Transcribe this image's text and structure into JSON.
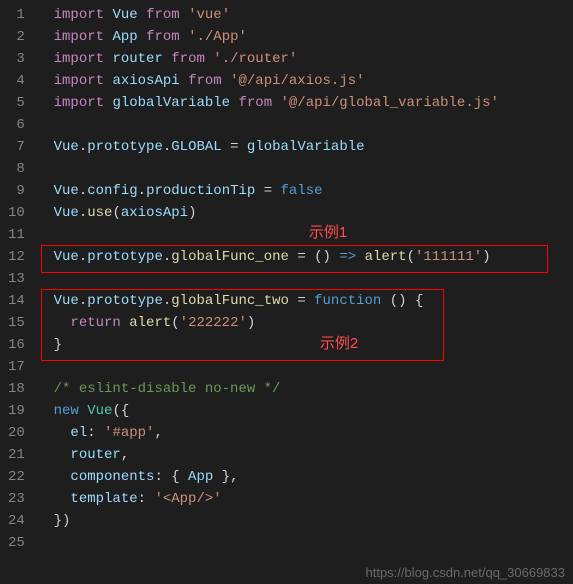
{
  "lines": {
    "count": 25,
    "l1": {
      "kw": "import",
      "v": "Vue",
      "from": "from",
      "s": "'vue'"
    },
    "l2": {
      "kw": "import",
      "v": "App",
      "from": "from",
      "s": "'./App'"
    },
    "l3": {
      "kw": "import",
      "v": "router",
      "from": "from",
      "s": "'./router'"
    },
    "l4": {
      "kw": "import",
      "v": "axiosApi",
      "from": "from",
      "s": "'@/api/axios.js'"
    },
    "l5": {
      "kw": "import",
      "v": "globalVariable",
      "from": "from",
      "s": "'@/api/global_variable.js'"
    },
    "l7": {
      "a": "Vue",
      "b": "prototype",
      "c": "GLOBAL",
      "eq": "=",
      "d": "globalVariable"
    },
    "l9": {
      "a": "Vue",
      "b": "config",
      "c": "productionTip",
      "eq": "=",
      "d": "false"
    },
    "l10": {
      "a": "Vue",
      "b": "use",
      "c": "axiosApi"
    },
    "l12": {
      "a": "Vue",
      "b": "prototype",
      "c": "globalFunc_one",
      "eq": "=",
      "arrow": "=>",
      "fn": "alert",
      "arg": "'111111'"
    },
    "l14": {
      "a": "Vue",
      "b": "prototype",
      "c": "globalFunc_two",
      "eq": "=",
      "fk": "function"
    },
    "l15": {
      "ret": "return",
      "fn": "alert",
      "arg": "'222222'"
    },
    "l18": {
      "c": "/* eslint-disable no-new */"
    },
    "l19": {
      "nk": "new",
      "cls": "Vue"
    },
    "l20": {
      "k": "el",
      "v": "'#app'"
    },
    "l21": {
      "k": "router"
    },
    "l22": {
      "k": "components",
      "v": "App"
    },
    "l23": {
      "k": "template",
      "v": "'<App/>'"
    }
  },
  "annotations": {
    "label1": "示例1",
    "label2": "示例2"
  },
  "watermark": "https://blog.csdn.net/qq_30669833"
}
